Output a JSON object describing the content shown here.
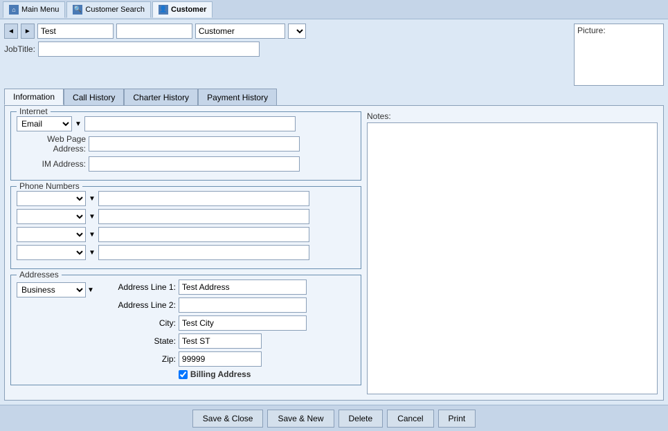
{
  "titlebar": {
    "tabs": [
      {
        "id": "main-menu",
        "label": "Main Menu",
        "icon": "🏠",
        "active": false
      },
      {
        "id": "customer-search",
        "label": "Customer Search",
        "icon": "🔍",
        "active": false
      },
      {
        "id": "customer",
        "label": "Customer",
        "icon": "👤",
        "active": true
      }
    ]
  },
  "header": {
    "first_name": "Test",
    "customer_type": "Customer",
    "jobtitle_label": "JobTitle:",
    "picture_label": "Picture:"
  },
  "tabs": [
    {
      "id": "information",
      "label": "Information",
      "active": true
    },
    {
      "id": "call-history",
      "label": "Call History",
      "active": false
    },
    {
      "id": "charter-history",
      "label": "Charter History",
      "active": false
    },
    {
      "id": "payment-history",
      "label": "Payment History",
      "active": false
    }
  ],
  "internet": {
    "section_title": "Internet",
    "email_type": "Email",
    "email_value": "",
    "web_page_label": "Web Page Address:",
    "web_page_value": "",
    "im_label": "IM Address:",
    "im_value": ""
  },
  "phone_numbers": {
    "section_title": "Phone Numbers",
    "phones": [
      {
        "type": "",
        "value": ""
      },
      {
        "type": "",
        "value": ""
      },
      {
        "type": "",
        "value": ""
      },
      {
        "type": "",
        "value": ""
      }
    ]
  },
  "addresses": {
    "section_title": "Addresses",
    "type": "Business",
    "line1_label": "Address Line 1:",
    "line1_value": "Test Address",
    "line2_label": "Address Line 2:",
    "line2_value": "",
    "city_label": "City:",
    "city_value": "Test City",
    "state_label": "State:",
    "state_value": "Test ST",
    "zip_label": "Zip:",
    "zip_value": "99999",
    "billing_label": "Billing Address",
    "billing_checked": true
  },
  "notes": {
    "label": "Notes:",
    "value": ""
  },
  "buttons": {
    "save_close": "Save & Close",
    "save_new": "Save & New",
    "delete": "Delete",
    "cancel": "Cancel",
    "print": "Print"
  }
}
